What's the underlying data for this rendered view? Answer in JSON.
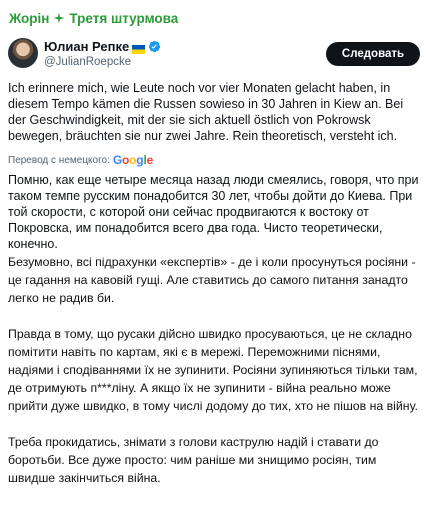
{
  "channel": {
    "left_text": "Жорін",
    "separator_icon": "cross-icon",
    "right_text": "Третя штурмова",
    "color": "#2e9a3a"
  },
  "tweet": {
    "author_name": "Юлиан Репке",
    "flag_icon": "ukraine-flag-icon",
    "verified_icon": "verified-badge-icon",
    "handle": "@JulianRoepcke",
    "follow_label": "Следовать",
    "original_text": "Ich erinnere mich, wie Leute noch vor vier Monaten gelacht haben, in diesem Tempo kämen die Russen sowieso in 30 Jahren in Kiew an. Bei der Geschwindigkeit, mit der sie sich aktuell östlich von Pokrowsk bewegen, bräuchten sie nur zwei Jahre. Rein theoretisch, versteht ich.",
    "translation_label": "Перевод с немецкого:",
    "google_letters": [
      "G",
      "o",
      "o",
      "g",
      "l",
      "e"
    ],
    "translated_text": "Помню, как еще четыре месяца назад люди смеялись, говоря, что при таком темпе русским понадобится 30 лет, чтобы дойти до Киева. При той скорости, с которой они сейчас продвигаются к востоку от Покровска, им понадобится всего два года. Чисто теоретически, конечно."
  },
  "comment": {
    "paragraphs": [
      "Безумовно, всі підрахунки «експертів» - де і коли просунуться росіяни - це гадання на кавовій гущі. Але ставитись до самого питання занадто легко не радив би.",
      "Правда в тому, що русаки дійсно швидко просуваються, це не складно помітити навіть по картам, які є в мережі. Переможними піснями, надіями і сподіваннями їх не зупинити. Росіяни зупиняються тільки там, де отримують п***ліну. А якщо їх не зупинити - війна реально може прийти дуже швидко, в тому числі додому до тих, хто не пішов на війну.",
      "Треба прокидатись, знімати з голови каструлю надій і ставати до боротьби. Все дуже просто: чим раніше ми знищимо росіян, тим швидше закінчиться війна."
    ]
  },
  "colors": {
    "text": "#0f1419",
    "secondary": "#536471",
    "button_bg": "#0f1419",
    "verified": "#1d9bf0"
  }
}
